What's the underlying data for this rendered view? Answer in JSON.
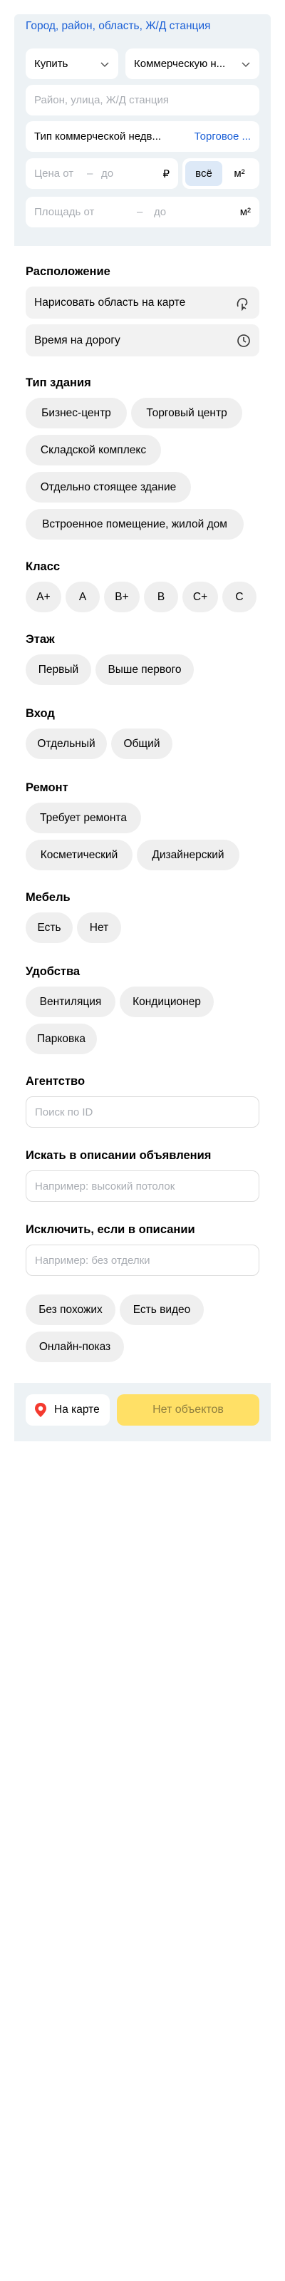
{
  "location_link": "Город, район, область, Ж/Д станция",
  "deal_select": "Купить",
  "property_select": "Коммерческую н...",
  "address_placeholder": "Район, улица, Ж/Д станция",
  "commercial_type": {
    "label": "Тип коммерческой недв...",
    "value": "Торговое ..."
  },
  "price": {
    "from": "Цена от",
    "dash": "–",
    "to": "до",
    "currency": "₽",
    "all": "всё",
    "unit": "м²"
  },
  "area": {
    "from": "Площадь от",
    "dash": "–",
    "to": "до",
    "unit": "м²"
  },
  "location_section": {
    "title": "Расположение",
    "draw_area": "Нарисовать область на карте",
    "travel_time": "Время на дорогу"
  },
  "building_type": {
    "title": "Тип здания",
    "chips": [
      "Бизнес-центр",
      "Торговый центр",
      "Складской комплекс",
      "Отдельно стоящее здание",
      "Встроенное помещение, жилой дом"
    ]
  },
  "class_section": {
    "title": "Класс",
    "chips": [
      "A+",
      "A",
      "B+",
      "B",
      "C+",
      "C"
    ]
  },
  "floor": {
    "title": "Этаж",
    "chips": [
      "Первый",
      "Выше первого"
    ]
  },
  "entrance": {
    "title": "Вход",
    "chips": [
      "Отдельный",
      "Общий"
    ]
  },
  "repair": {
    "title": "Ремонт",
    "chips": [
      "Требует ремонта",
      "Косметический",
      "Дизайнерский"
    ]
  },
  "furniture": {
    "title": "Мебель",
    "chips": [
      "Есть",
      "Нет"
    ]
  },
  "amenities": {
    "title": "Удобства",
    "chips": [
      "Вентиляция",
      "Кондиционер",
      "Парковка"
    ]
  },
  "agency": {
    "title": "Агентство",
    "placeholder": "Поиск по ID"
  },
  "search_desc": {
    "title": "Искать в описании объявления",
    "placeholder": "Например: высокий потолок"
  },
  "exclude_desc": {
    "title": "Исключить, если в описании",
    "placeholder": "Например: без отделки"
  },
  "extra_chips": [
    "Без похожих",
    "Есть видео",
    "Онлайн-показ"
  ],
  "bottom": {
    "map_label": "На карте",
    "objects_label": "Нет объектов"
  },
  "colors": {
    "link": "#1a5fd6",
    "panel": "#edf2f5",
    "chip": "#efefef",
    "accent_yellow": "#ffe066",
    "pin_red": "#f43a2f"
  }
}
